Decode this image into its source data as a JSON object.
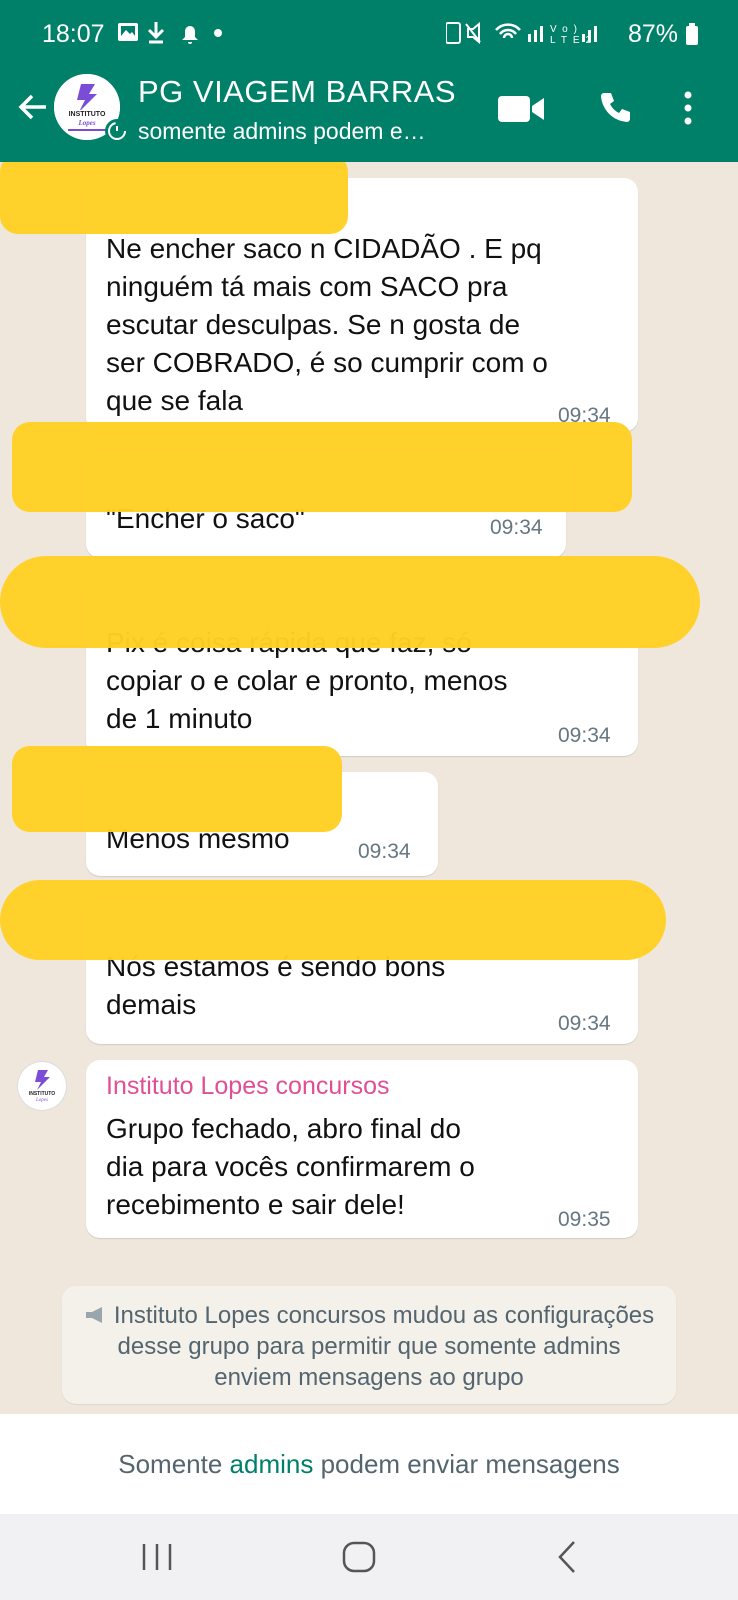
{
  "status_bar": {
    "time": "18:07",
    "battery": "87%"
  },
  "header": {
    "title": "PG VIAGEM BARRAS",
    "subtitle": "somente admins podem e…",
    "avatar_text": "INSTITUTO LOPES"
  },
  "messages": [
    {
      "text_lines": [
        "Ne encher saco n CIDADÃO . E pq",
        "ninguém tá mais com SACO  pra",
        "escutar desculpas. Se n gosta de",
        "ser COBRADO, é so cumprir com o",
        "que se fala"
      ],
      "time": "09:34"
    },
    {
      "text_lines": [
        "\"Encher o saco\""
      ],
      "time": "09:34"
    },
    {
      "text_lines": [
        "Pix é coisa rápida que faz, só",
        "copiar o e colar e pronto, menos",
        "de 1 minuto"
      ],
      "time": "09:34"
    },
    {
      "text_lines": [
        "Menos mesmo"
      ],
      "time": "09:34"
    },
    {
      "text_lines": [
        "Nós estamos é sendo bons",
        "demais"
      ],
      "time": "09:34"
    },
    {
      "sender": "Instituto Lopes concursos",
      "text_lines": [
        "Grupo fechado, abro final do",
        "dia para vocês confirmarem o",
        "recebimento e sair dele!"
      ],
      "time": "09:35"
    }
  ],
  "system_message": "Instituto Lopes concursos mudou as configurações desse grupo para permitir que somente admins enviem mensagens ao grupo",
  "footer": {
    "prefix": "Somente ",
    "link": "admins",
    "suffix": " podem enviar mensagens"
  },
  "colors": {
    "header_bg": "#008069",
    "chat_bg": "#efe7dc",
    "redaction": "#ffd024",
    "sender_name": "#e04f95"
  },
  "icons": [
    "back-arrow-icon",
    "video-call-icon",
    "phone-icon",
    "more-options-icon",
    "megaphone-icon",
    "recent-apps-icon",
    "home-icon",
    "nav-back-icon"
  ]
}
